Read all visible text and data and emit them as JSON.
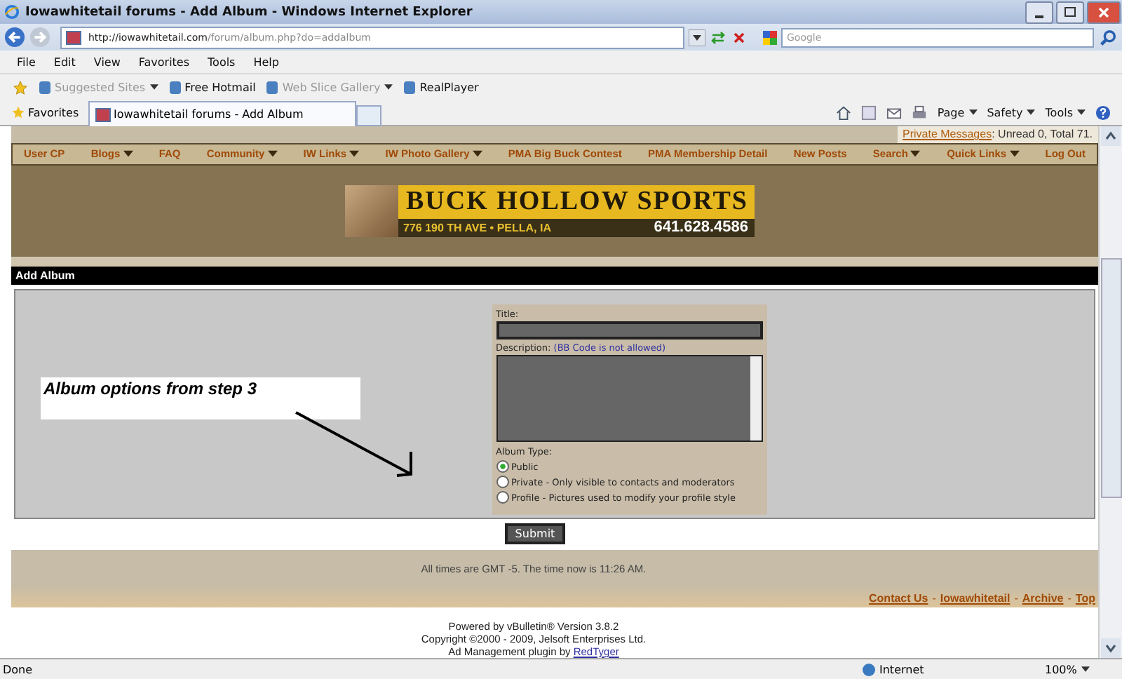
{
  "window": {
    "title": "Iowawhitetail forums - Add Album - Windows Internet Explorer"
  },
  "address": {
    "url_host": "http://iowawhitetail.com",
    "url_path": "/forum/album.php?do=addalbum"
  },
  "search": {
    "placeholder": "Google"
  },
  "menu": [
    "File",
    "Edit",
    "View",
    "Favorites",
    "Tools",
    "Help"
  ],
  "links_bar": [
    {
      "label": "Suggested Sites",
      "disabled": true,
      "has_menu": true
    },
    {
      "label": "Free Hotmail",
      "disabled": false,
      "has_menu": false
    },
    {
      "label": "Web Slice Gallery",
      "disabled": true,
      "has_menu": true
    },
    {
      "label": "RealPlayer",
      "disabled": false,
      "has_menu": false
    }
  ],
  "favorites": {
    "label": "Favorites"
  },
  "tab": {
    "label": "Iowawhitetail forums - Add Album"
  },
  "command_bar": [
    "Page",
    "Safety",
    "Tools"
  ],
  "private_messages": {
    "link": "Private Messages",
    "text": ": Unread 0, Total 71."
  },
  "nav": [
    {
      "label": "User CP",
      "has_menu": false
    },
    {
      "label": "Blogs",
      "has_menu": true
    },
    {
      "label": "FAQ",
      "has_menu": false
    },
    {
      "label": "Community",
      "has_menu": true
    },
    {
      "label": "IW Links",
      "has_menu": true
    },
    {
      "label": "IW Photo Gallery",
      "has_menu": true
    },
    {
      "label": "PMA Big Buck Contest",
      "has_menu": false
    },
    {
      "label": "PMA Membership Detail",
      "has_menu": false
    },
    {
      "label": "New Posts",
      "has_menu": false
    },
    {
      "label": "Search",
      "has_menu": true
    },
    {
      "label": "Quick Links",
      "has_menu": true
    },
    {
      "label": "Log Out",
      "has_menu": false
    }
  ],
  "banner": {
    "name": "BUCK HOLLOW SPORTS",
    "address": "776 190 TH AVE  •  PELLA, IA",
    "phone": "641.628.4586"
  },
  "section_title": "Add Album",
  "form": {
    "title_label": "Title:",
    "description_label": "Description:",
    "description_note": "(BB Code is not allowed)",
    "album_type_label": "Album Type:",
    "options": [
      {
        "label": "Public",
        "selected": true
      },
      {
        "label": "Private - Only visible to contacts and moderators",
        "selected": false
      },
      {
        "label": "Profile - Pictures used to modify your profile style",
        "selected": false
      }
    ],
    "submit": "Submit"
  },
  "annotation": {
    "text": "Album options from step 3"
  },
  "footer": {
    "time_text": "All times are GMT -5. The time now is 11:26 AM.",
    "links": [
      "Contact Us",
      "Iowawhitetail",
      "Archive",
      "Top"
    ],
    "separator": "-",
    "powered": [
      "Powered by vBulletin® Version 3.8.2",
      "Copyright ©2000 - 2009, Jelsoft Enterprises Ltd."
    ],
    "ad_text": "Ad Management plugin by",
    "ad_link": "RedTyger"
  },
  "status": {
    "text": "Done",
    "zone": "Internet",
    "zoom": "100%"
  }
}
